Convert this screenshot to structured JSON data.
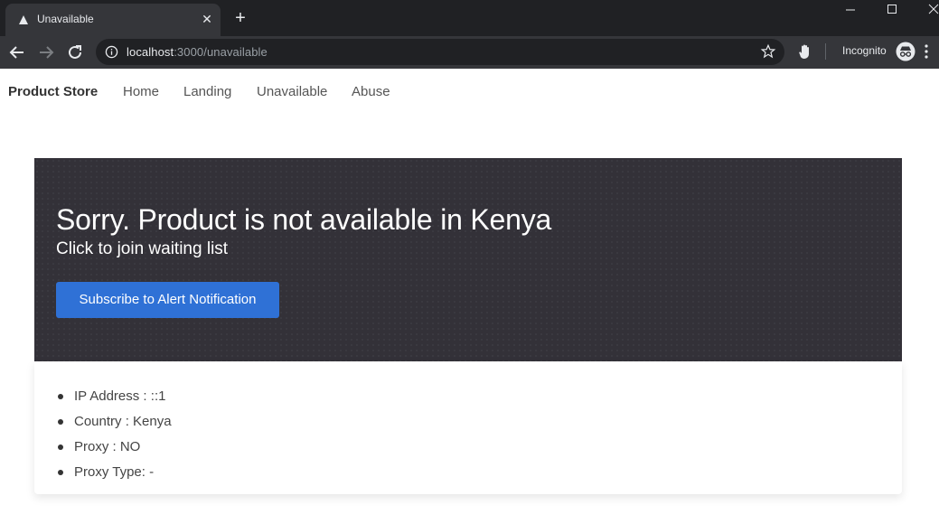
{
  "browser": {
    "tab_title": "Unavailable",
    "url_host": "localhost",
    "url_path": ":3000/unavailable",
    "incognito_label": "Incognito"
  },
  "navbar": {
    "brand": "Product Store",
    "links": [
      "Home",
      "Landing",
      "Unavailable",
      "Abuse"
    ]
  },
  "hero": {
    "title": "Sorry. Product is not available in Kenya",
    "subtitle": "Click to join waiting list",
    "button_label": "Subscribe to Alert Notification"
  },
  "info": {
    "items": [
      "IP Address : ::1",
      "Country : Kenya",
      "Proxy : NO",
      "Proxy Type: -"
    ]
  },
  "colors": {
    "hero_bg": "#333138",
    "button_bg": "#2f71d6",
    "chrome_dark": "#202124"
  }
}
